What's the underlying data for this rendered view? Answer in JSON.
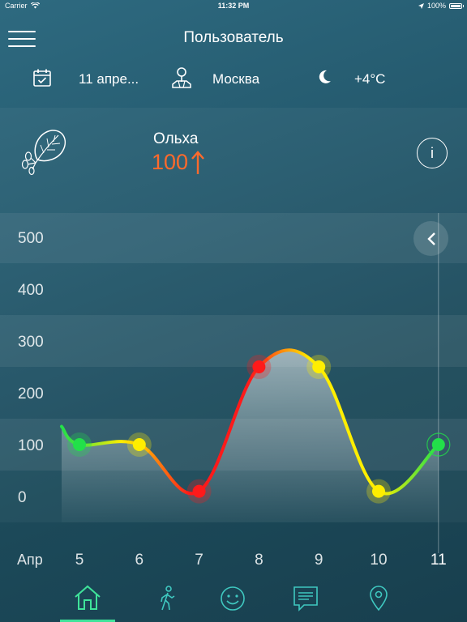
{
  "status_bar": {
    "carrier": "Carrier",
    "time": "11:32 PM",
    "battery": "100%"
  },
  "header": {
    "title": "Пользователь"
  },
  "info_row": {
    "date": "11 апре...",
    "city": "Москва",
    "temperature": "+4°C"
  },
  "allergen": {
    "name": "Ольха",
    "level": "100",
    "trend_color": "#ff6a2c"
  },
  "icons": {
    "menu": "menu-icon",
    "calendar": "calendar-icon",
    "location": "location-pin-icon",
    "weather": "moon-icon",
    "allergen": "leaf-icon",
    "info": "info-icon",
    "back": "chevron-left-icon"
  },
  "tabs": [
    {
      "icon": "home-icon",
      "active": true
    },
    {
      "icon": "walk-icon",
      "active": false
    },
    {
      "icon": "smiley-icon",
      "active": false
    },
    {
      "icon": "message-icon",
      "active": false
    },
    {
      "icon": "map-pin-icon",
      "active": false
    }
  ],
  "colors": {
    "active_tab": "#3fe39a",
    "icon_teal": "#3fc8c0",
    "low": "#22e04a",
    "medium": "#ffee00",
    "high": "#ff1a1a"
  },
  "chart_data": {
    "type": "line",
    "x_label": "Апр",
    "categories": [
      "5",
      "6",
      "7",
      "8",
      "9",
      "10",
      "11"
    ],
    "values": [
      100,
      100,
      10,
      250,
      250,
      10,
      100
    ],
    "levels": [
      "low",
      "medium",
      "high",
      "high",
      "medium",
      "medium",
      "low"
    ],
    "y_ticks": [
      0,
      100,
      200,
      300,
      400,
      500
    ],
    "ylim": [
      0,
      500
    ],
    "highlighted": "11",
    "grid": "bands"
  }
}
